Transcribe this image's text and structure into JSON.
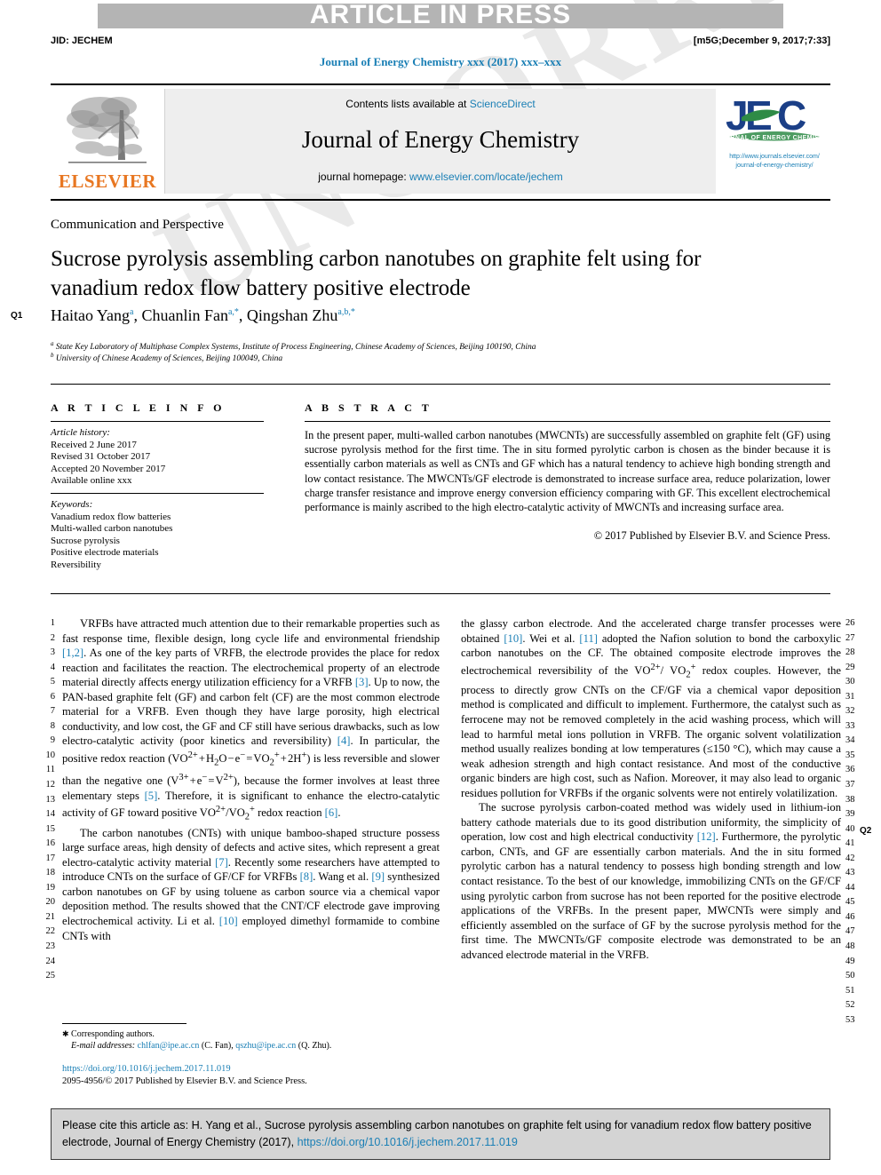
{
  "header": {
    "banner": "ARTICLE IN PRESS",
    "jid": "JID: JECHEM",
    "build_tag": "[m5G;December 9, 2017;7:33]",
    "running_head": "Journal of Energy Chemistry xxx (2017) xxx–xxx"
  },
  "masthead": {
    "publisher_logo_text": "ELSEVIER",
    "contents_prefix": "Contents lists available at ",
    "contents_link": "ScienceDirect",
    "journal_name": "Journal of Energy Chemistry",
    "homepage_prefix": "journal homepage: ",
    "homepage_link": "www.elsevier.com/locate/jechem",
    "jec_logo_text": "JEC",
    "jec_logo_tagline": "JOURNAL OF ENERGY CHEMISTRY",
    "jec_url_line1": "http://www.journals.elsevier.com/",
    "jec_url_line2": "journal-of-energy-chemistry/"
  },
  "article": {
    "section_kind": "Communication and Perspective",
    "title": "Sucrose pyrolysis assembling carbon nanotubes on graphite felt using for vanadium redox flow battery positive electrode",
    "authors_html": "Haitao Yang<sup>a</sup>, Chuanlin Fan<sup>a,*</sup>, Qingshan Zhu<sup>a,b,*</sup>",
    "affiliation_a": "State Key Laboratory of Multiphase Complex Systems, Institute of Process Engineering, Chinese Academy of Sciences, Beijing 100190, China",
    "affiliation_b": "University of Chinese Academy of Sciences, Beijing 100049, China",
    "query_marker_1": "Q1",
    "query_marker_2": "Q2"
  },
  "info": {
    "heading": "A R T I C L E  I N F O",
    "history_label": "Article history:",
    "history": [
      "Received 2 June 2017",
      "Revised 31 October 2017",
      "Accepted 20 November 2017",
      "Available online xxx"
    ],
    "keywords_label": "Keywords:",
    "keywords": [
      "Vanadium redox flow batteries",
      "Multi-walled carbon nanotubes",
      "Sucrose pyrolysis",
      "Positive electrode materials",
      "Reversibility"
    ]
  },
  "abstract": {
    "heading": "A B S T R A C T",
    "text": "In the present paper, multi-walled carbon nanotubes (MWCNTs) are successfully assembled on graphite felt (GF) using sucrose pyrolysis method for the first time. The in situ formed pyrolytic carbon is chosen as the binder because it is essentially carbon materials as well as CNTs and GF which has a natural tendency to achieve high bonding strength and low contact resistance. The MWCNTs/GF electrode is demonstrated to increase surface area, reduce polarization, lower charge transfer resistance and improve energy conversion efficiency comparing with GF. This excellent electrochemical performance is mainly ascribed to the high electro-catalytic activity of MWCNTs and increasing surface area.",
    "copyright": "© 2017 Published by Elsevier B.V. and Science Press."
  },
  "body": {
    "left_line_numbers": "1\n2\n3\n4\n5\n6\n7\n8\n9\n10\n11\n12\n13\n14\n15\n16\n17\n18\n19\n20\n21\n22\n23\n24\n25",
    "right_line_numbers": "26\n27\n28\n29\n30\n31\n32\n33\n34\n35\n36\n37\n38\n39\n40\n41\n42\n43\n44\n45\n46\n47\n48\n49\n50\n51\n52\n53",
    "left_paragraph_1": "VRFBs have attracted much attention due to their remarkable properties such as fast response time, flexible design, long cycle life and environmental friendship [1,2]. As one of the key parts of VRFB, the electrode provides the place for redox reaction and facilitates the reaction. The electrochemical property of an electrode material directly affects energy utilization efficiency for a VRFB [3]. Up to now, the PAN-based graphite felt (GF) and carbon felt (CF) are the most common electrode material for a VRFB. Even though they have large porosity, high electrical conductivity, and low cost, the GF and CF still have serious drawbacks, such as low electro-catalytic activity (poor kinetics and reversibility) [4]. In particular, the positive redox reaction (VO2+ + H2O − e− = VO2+ + 2H+) is less reversible and slower than the negative one (V3+ + e− = V2+), because the former involves at least three elementary steps [5]. Therefore, it is significant to enhance the electro-catalytic activity of GF toward positive VO2+/VO2+ redox reaction [6].",
    "left_paragraph_2": "The carbon nanotubes (CNTs) with unique bamboo-shaped structure possess large surface areas, high density of defects and active sites, which represent a great electro-catalytic activity material [7]. Recently some researchers have attempted to introduce CNTs on the surface of GF/CF for VRFBs [8]. Wang et al. [9] synthesized carbon nanotubes on GF by using toluene as carbon source via a chemical vapor deposition method. The results showed that the CNT/CF electrode gave improving electrochemical activity. Li et al. [10] employed dimethyl formamide to combine CNTs with",
    "right_paragraph_1": "the glassy carbon electrode. And the accelerated charge transfer processes were obtained [10]. Wei et al. [11] adopted the Nafion solution to bond the carboxylic carbon nanotubes on the CF. The obtained composite electrode improves the electrochemical reversibility of the VO2+/ VO2+ redox couples. However, the process to directly grow CNTs on the CF/GF via a chemical vapor deposition method is complicated and difficult to implement. Furthermore, the catalyst such as ferrocene may not be removed completely in the acid washing process, which will lead to harmful metal ions pollution in VRFB. The organic solvent volatilization method usually realizes bonding at low temperatures (≤150 °C), which may cause a weak adhesion strength and high contact resistance. And most of the conductive organic binders are high cost, such as Nafion. Moreover, it may also lead to organic residues pollution for VRFBs if the organic solvents were not entirely volatilization.",
    "right_paragraph_2": "The sucrose pyrolysis carbon-coated method was widely used in lithium-ion battery cathode materials due to its good distribution uniformity, the simplicity of operation, low cost and high electrical conductivity [12]. Furthermore, the pyrolytic carbon, CNTs, and GF are essentially carbon materials. And the in situ formed pyrolytic carbon has a natural tendency to possess high bonding strength and low contact resistance. To the best of our knowledge, immobilizing CNTs on the GF/CF using pyrolytic carbon from sucrose has not been reported for the positive electrode applications of the VRFBs. In the present paper, MWCNTs were simply and efficiently assembled on the surface of GF by the sucrose pyrolysis method for the first time. The MWCNTs/GF composite electrode was demonstrated to be an advanced electrode material in the VRFB."
  },
  "footer": {
    "corresponding_label": "Corresponding authors.",
    "email_label": "E-mail addresses:",
    "email_1": "chlfan@ipe.ac.cn",
    "email_1_owner": "(C. Fan),",
    "email_2": "qszhu@ipe.ac.cn",
    "email_2_owner": "(Q. Zhu).",
    "doi": "https://doi.org/10.1016/j.jechem.2017.11.019",
    "issn_line": "2095-4956/© 2017 Published by Elsevier B.V. and Science Press."
  },
  "cite_box": {
    "prefix": "Please cite this article as: H. Yang et al., Sucrose pyrolysis assembling carbon nanotubes on graphite felt using for vanadium redox flow battery positive electrode, Journal of Energy Chemistry (2017), ",
    "link": "https://doi.org/10.1016/j.jechem.2017.11.019"
  },
  "watermark": {
    "text_line1": "UNCORRECTED PROOF"
  },
  "colors": {
    "link": "#1a7fb5",
    "banner_bg": "#b4b4b4",
    "masthead_panel": "#eeeeee",
    "elsevier_orange": "#E87722",
    "jec_blue": "#1b3f87",
    "jec_green": "#2e8b46",
    "cite_bg": "#d4d4d4"
  }
}
